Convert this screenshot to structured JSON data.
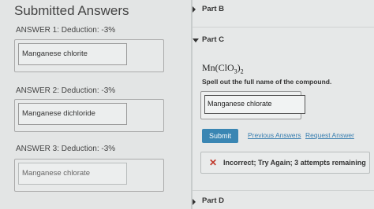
{
  "left_panel": {
    "title": "Submitted Answers",
    "answers": [
      {
        "label": "ANSWER 1: Deduction: -3%",
        "value": "Manganese chlorite"
      },
      {
        "label": "ANSWER 2: Deduction: -3%",
        "value": "Manganese dichloride"
      },
      {
        "label": "ANSWER 3: Deduction: -3%",
        "value": "Manganese chlorate"
      }
    ]
  },
  "right_panel": {
    "part_b": "Part B",
    "part_c": "Part C",
    "formula": {
      "base": "Mn(ClO",
      "sub1": "3",
      "close": ")",
      "sub2": "2"
    },
    "instruction": "Spell out the full name of the compound.",
    "input_value": "Manganese chlorate",
    "submit_label": "Submit",
    "previous_answers_label": "Previous Answers",
    "request_answer_label": "Request Answer",
    "feedback": {
      "icon": "x-icon",
      "text": "Incorrect; Try Again; 3 attempts remaining"
    },
    "part_d": "Part D"
  },
  "colors": {
    "submit": "#3a86b3",
    "link": "#3a7fb0",
    "incorrect": "#c0392b"
  }
}
